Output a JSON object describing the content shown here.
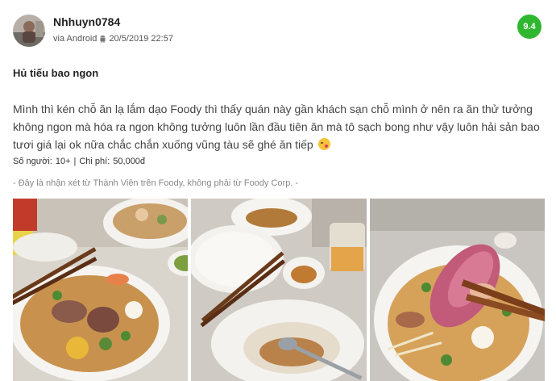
{
  "review": {
    "user_name": "Nhhuyn0784",
    "via": "via Android",
    "date": "20/5/2019 22:57",
    "score": "9.4",
    "title": "Hủ tiếu bao ngon",
    "body": "Mình thì kén chỗ ăn lạ lắm dạo Foody thì thấy quán này gần khách sạn chỗ mình ở nên ra ăn thử tưởng không ngon mà hóa ra ngon không tưởng luôn lần đầu tiên ăn mà tô sạch bong như vậy luôn hải sản bao tươi giá lại ok nữa chắc chắn xuống vũng tàu sẽ ghé ăn tiếp",
    "people_label": "Số người:",
    "people_value": "10+",
    "separator": "|",
    "price_label": "Chi phí:",
    "price_value": "50,000đ",
    "disclaimer": "- Đây là nhận xét từ Thành Viên trên Foody, không phải từ Foody Corp. -"
  },
  "colors": {
    "score_badge": "#2fb82f"
  },
  "icons": {
    "android": "android-icon",
    "emoji": "face-kiss-emoji-icon"
  }
}
